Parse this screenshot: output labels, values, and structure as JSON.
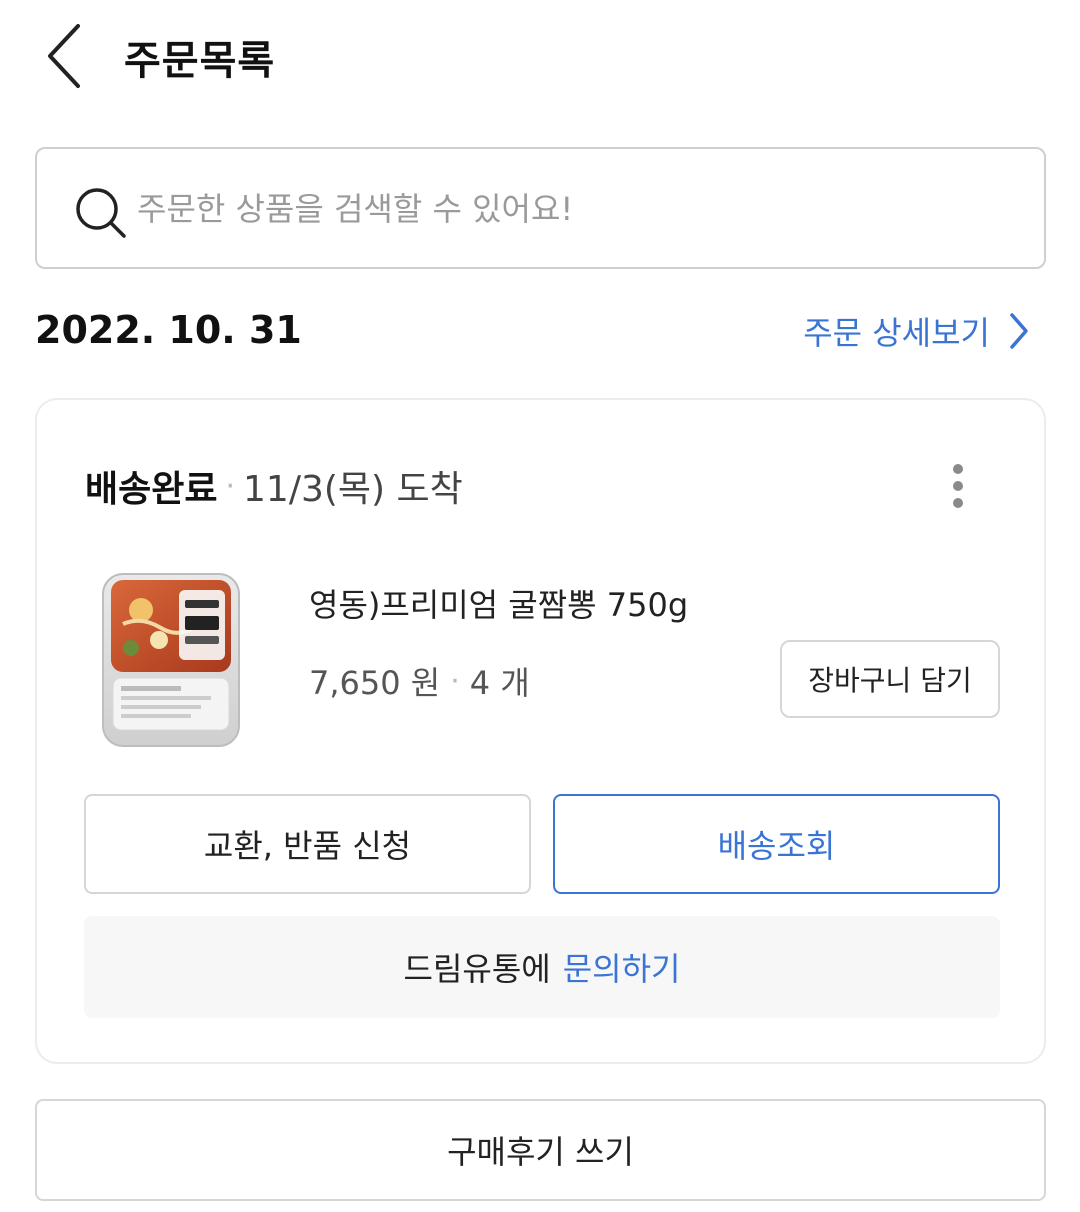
{
  "header": {
    "title": "주문목록"
  },
  "search": {
    "placeholder": "주문한 상품을 검색할 수 있어요!"
  },
  "order": {
    "date": "2022. 10. 31",
    "detail_link": "주문 상세보기",
    "status": "배송완료",
    "separator": "·",
    "arrival": "11/3(목) 도착",
    "product": {
      "name": "영동)프리미엄 굴짬뽕 750g",
      "price": "7,650 원",
      "quantity": "4 개"
    },
    "cart_button": "장바구니 담기",
    "exchange_button": "교환, 반품 신청",
    "tracking_button": "배송조회",
    "inquiry_prefix": "드림유통에",
    "inquiry_link": "문의하기"
  },
  "review_button": "구매후기 쓰기",
  "colors": {
    "accent": "#3a74d4",
    "border": "#d6d6d6",
    "inquiry_bg": "#f7f7f7"
  }
}
